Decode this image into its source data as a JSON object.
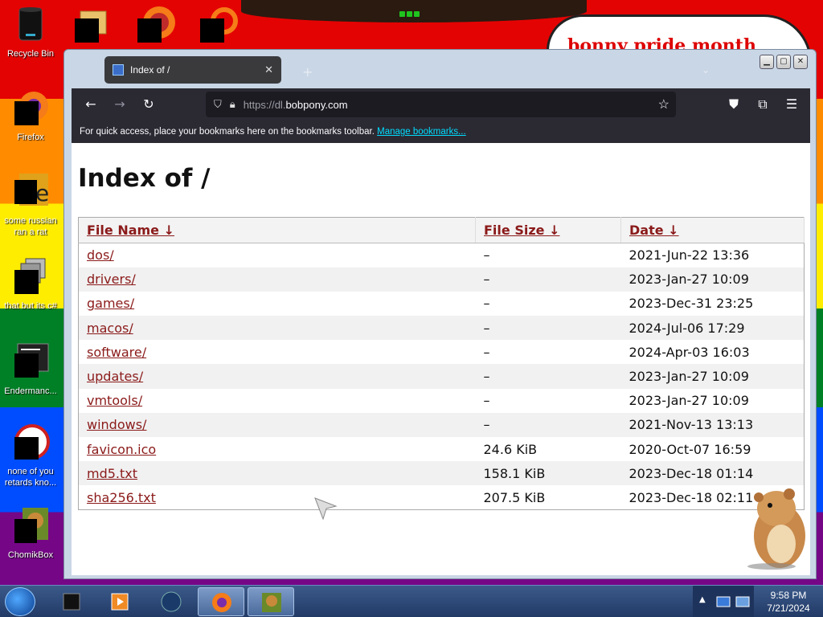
{
  "desktop": {
    "banner_text": "bonny pride month",
    "icons": [
      {
        "label": "Recycle Bin",
        "icon": "recycle-bin-icon"
      },
      {
        "label": "Firefox",
        "icon": "firefox-icon"
      },
      {
        "label": "some russian ran a rat",
        "icon": "rat-icon"
      },
      {
        "label": "that but its c#",
        "icon": "folder-icon"
      },
      {
        "label": "Endermanc...",
        "icon": "terminal-icon"
      },
      {
        "label": "none of you retards kno...",
        "icon": "browser-icon"
      },
      {
        "label": "ChomikBox",
        "icon": "chomikbox-icon"
      }
    ]
  },
  "browser": {
    "tab_title": "Index of /",
    "url_prefix": "https://dl.",
    "url_domain": "bobpony.com",
    "bookmarks_message": "For quick access, place your bookmarks here on the bookmarks toolbar.",
    "bookmarks_link": "Manage bookmarks...",
    "window_buttons": {
      "minimize": "▁",
      "maximize": "▢",
      "close": "✕"
    }
  },
  "page": {
    "heading": "Index of /",
    "columns": {
      "name": "File Name  ↓",
      "size": "File Size  ↓",
      "date": "Date  ↓"
    },
    "rows": [
      {
        "name": "dos/",
        "size": "–",
        "date": "2021-Jun-22 13:36"
      },
      {
        "name": "drivers/",
        "size": "–",
        "date": "2023-Jan-27 10:09"
      },
      {
        "name": "games/",
        "size": "–",
        "date": "2023-Dec-31 23:25"
      },
      {
        "name": "macos/",
        "size": "–",
        "date": "2024-Jul-06 17:29"
      },
      {
        "name": "software/",
        "size": "–",
        "date": "2024-Apr-03 16:03"
      },
      {
        "name": "updates/",
        "size": "–",
        "date": "2023-Jan-27 10:09"
      },
      {
        "name": "vmtools/",
        "size": "–",
        "date": "2023-Jan-27 10:09"
      },
      {
        "name": "windows/",
        "size": "–",
        "date": "2021-Nov-13 13:13"
      },
      {
        "name": "favicon.ico",
        "size": "24.6 KiB",
        "date": "2020-Oct-07 16:59"
      },
      {
        "name": "md5.txt",
        "size": "158.1 KiB",
        "date": "2023-Dec-18 01:14"
      },
      {
        "name": "sha256.txt",
        "size": "207.5 KiB",
        "date": "2023-Dec-18 02:11"
      }
    ]
  },
  "taskbar": {
    "time": "9:58 PM",
    "date": "7/21/2024"
  },
  "colors": {
    "link": "#8b1a1a",
    "accent_link": "#00ddff",
    "browser_dark": "#2b2a33"
  }
}
